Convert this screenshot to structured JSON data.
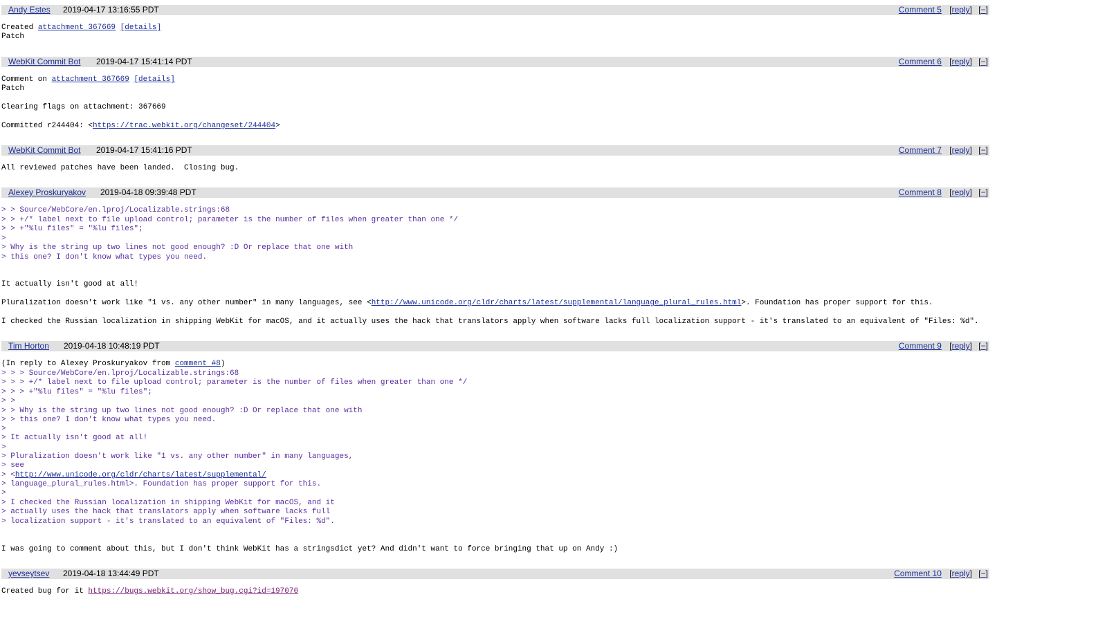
{
  "comments": [
    {
      "author": "Andy Estes",
      "timestamp": "2019-04-17 13:16:55 PDT",
      "comment_label": "Comment 5",
      "reply": "reply",
      "collapse": "−",
      "body": {
        "line1_prefix": "Created ",
        "line1_link": "attachment 367669",
        "line1_details": "[details]",
        "line2": "Patch"
      }
    },
    {
      "author": "WebKit Commit Bot",
      "timestamp": "2019-04-17 15:41:14 PDT",
      "comment_label": "Comment 6",
      "reply": "reply",
      "collapse": "−",
      "body": {
        "line1_prefix": "Comment on ",
        "line1_link": "attachment 367669",
        "line1_details": "[details]",
        "line2": "Patch",
        "line3": "Clearing flags on attachment: 367669",
        "line4_prefix": "Committed r244404: <",
        "line4_link": "https://trac.webkit.org/changeset/244404",
        "line4_suffix": ">"
      }
    },
    {
      "author": "WebKit Commit Bot",
      "timestamp": "2019-04-17 15:41:16 PDT",
      "comment_label": "Comment 7",
      "reply": "reply",
      "collapse": "−",
      "body": {
        "line1": "All reviewed patches have been landed.  Closing bug."
      }
    },
    {
      "author": "Alexey Proskuryakov",
      "timestamp": "2019-04-18 09:39:48 PDT",
      "comment_label": "Comment 8",
      "reply": "reply",
      "collapse": "−",
      "body": {
        "q1": "> > Source/WebCore/en.lproj/Localizable.strings:68",
        "q2": "> > +/* label next to file upload control; parameter is the number of files when greater than one */",
        "q3": "> > +\"%lu files\" = \"%lu files\";",
        "q4": ">",
        "q5": "> Why is the string up two lines not good enough? :D Or replace that one with",
        "q6": "> this one? I don't know what types you need.",
        "p1": "It actually isn't good at all!",
        "p2_prefix": "Pluralization doesn't work like \"1 vs. any other number\" in many languages, see <",
        "p2_link": "http://www.unicode.org/cldr/charts/latest/supplemental/language_plural_rules.html",
        "p2_suffix": ">. Foundation has proper support for this.",
        "p3": "I checked the Russian localization in shipping WebKit for macOS, and it actually uses the hack that translators apply when software lacks full localization support - it's translated to an equivalent of \"Files: %d\"."
      }
    },
    {
      "author": "Tim Horton",
      "timestamp": "2019-04-18 10:48:19 PDT",
      "comment_label": "Comment 9",
      "reply": "reply",
      "collapse": "−",
      "body": {
        "intro_prefix": "(In reply to Alexey Proskuryakov from ",
        "intro_link": "comment #8",
        "intro_suffix": ")",
        "q1": "> > > Source/WebCore/en.lproj/Localizable.strings:68",
        "q2": "> > > +/* label next to file upload control; parameter is the number of files when greater than one */",
        "q3": "> > > +\"%lu files\" = \"%lu files\";",
        "q4": "> >",
        "q5": "> > Why is the string up two lines not good enough? :D Or replace that one with",
        "q6": "> > this one? I don't know what types you need.",
        "q7": ">",
        "q8": "> It actually isn't good at all!",
        "q9": ">",
        "q10": "> Pluralization doesn't work like \"1 vs. any other number\" in many languages,",
        "q11": "> see",
        "q12_prefix": "> <",
        "q12_link": "http://www.unicode.org/cldr/charts/latest/supplemental/",
        "q13": "> language_plural_rules.html>. Foundation has proper support for this.",
        "q14": ">",
        "q15": "> I checked the Russian localization in shipping WebKit for macOS, and it",
        "q16": "> actually uses the hack that translators apply when software lacks full",
        "q17": "> localization support - it's translated to an equivalent of \"Files: %d\".",
        "p1": "I was going to comment about this, but I don't think WebKit has a stringsdict yet? And didn't want to force bringing that up on Andy :)"
      }
    },
    {
      "author": "yevseytsev",
      "timestamp": "2019-04-18 13:44:49 PDT",
      "comment_label": "Comment 10",
      "reply": "reply",
      "collapse": "−",
      "body": {
        "line1_prefix": "Created bug for it ",
        "line1_link": "https://bugs.webkit.org/show_bug.cgi?id=197070"
      }
    }
  ]
}
